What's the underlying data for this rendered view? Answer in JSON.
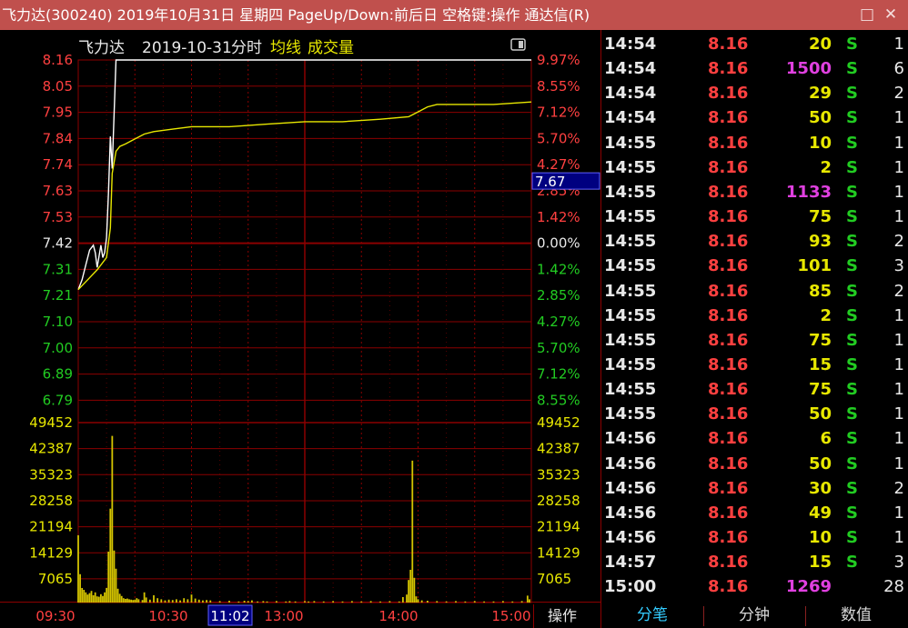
{
  "window": {
    "title": "飞力达(300240) 2019年10月31日 星期四 PageUp/Down:前后日 空格键:操作 通达信(R)",
    "maximize_glyph": "□",
    "close_glyph": "✕"
  },
  "chart_header": {
    "stock_name": "飞力达",
    "date": "2019-10-31",
    "mode": "分时",
    "avg_label": "均线",
    "volume_label": "成交量"
  },
  "price_axis": {
    "ticks": [
      "8.16",
      "8.05",
      "7.95",
      "7.84",
      "7.74",
      "7.63",
      "7.53",
      "7.42",
      "7.31",
      "7.21",
      "7.10",
      "7.00",
      "6.89",
      "6.79"
    ],
    "pct_ticks": [
      "9.97%",
      "8.55%",
      "7.12%",
      "5.70%",
      "4.27%",
      "2.85%",
      "1.42%",
      "0.00%",
      "1.42%",
      "2.85%",
      "4.27%",
      "5.70%",
      "7.12%",
      "8.55%"
    ],
    "marker_value": "7.67"
  },
  "volume_axis": {
    "ticks": [
      "49452",
      "42387",
      "35323",
      "28258",
      "21194",
      "14129",
      "7065"
    ]
  },
  "time_axis": {
    "labels": [
      "09:30",
      "10:30",
      "11:02",
      "13:00",
      "14:00",
      "15:00"
    ]
  },
  "operate_label": "操作",
  "colors": {
    "up": "#ff4040",
    "down": "#22cc22",
    "grid": "#8b0000",
    "price_line": "#ffffff",
    "avg_line": "#e8e800",
    "volume": "#d4c400",
    "selected_time_bg": "#000080"
  },
  "chart_data": {
    "type": "line",
    "x_unit": "minutes since 09:30 open (trading minutes)",
    "ylim": [
      6.68,
      8.16
    ],
    "prev_close": 7.42,
    "series": [
      {
        "name": "价格",
        "x": [
          0,
          2,
          4,
          6,
          8,
          9,
          10,
          12,
          13,
          14,
          15,
          16,
          17,
          18,
          20,
          22,
          24,
          25,
          26,
          28,
          30,
          32,
          34,
          36,
          38,
          40,
          42,
          45,
          48,
          50,
          55,
          60,
          70,
          80,
          100,
          130,
          140,
          160,
          180,
          200,
          210,
          215,
          220,
          230,
          240
        ],
        "values": [
          7.23,
          7.27,
          7.33,
          7.39,
          7.41,
          7.38,
          7.32,
          7.41,
          7.36,
          7.38,
          7.44,
          7.62,
          7.85,
          7.72,
          8.16,
          8.16,
          8.16,
          8.16,
          8.16,
          8.16,
          8.16,
          8.16,
          8.16,
          8.16,
          8.16,
          8.16,
          8.16,
          8.16,
          8.16,
          8.16,
          8.16,
          8.16,
          8.16,
          8.16,
          8.16,
          8.16,
          8.16,
          8.16,
          8.16,
          8.16,
          8.16,
          8.16,
          8.16,
          8.16,
          8.16
        ]
      },
      {
        "name": "均价",
        "x": [
          0,
          5,
          10,
          15,
          17,
          18,
          20,
          22,
          25,
          30,
          35,
          40,
          50,
          60,
          80,
          100,
          120,
          140,
          160,
          175,
          180,
          185,
          190,
          200,
          220,
          240
        ],
        "values": [
          7.23,
          7.27,
          7.31,
          7.36,
          7.48,
          7.7,
          7.79,
          7.81,
          7.82,
          7.84,
          7.86,
          7.87,
          7.88,
          7.89,
          7.89,
          7.9,
          7.91,
          7.91,
          7.92,
          7.93,
          7.95,
          7.97,
          7.98,
          7.98,
          7.98,
          7.99
        ]
      }
    ],
    "volume_series": {
      "name": "成交量",
      "ylim": [
        0,
        49452
      ],
      "bars": [
        [
          0,
          18500
        ],
        [
          1,
          7800
        ],
        [
          2,
          4000
        ],
        [
          3,
          3500
        ],
        [
          4,
          2800
        ],
        [
          5,
          2200
        ],
        [
          6,
          2600
        ],
        [
          7,
          3200
        ],
        [
          8,
          2000
        ],
        [
          9,
          2800
        ],
        [
          10,
          1700
        ],
        [
          11,
          1600
        ],
        [
          12,
          2300
        ],
        [
          13,
          1800
        ],
        [
          14,
          2800
        ],
        [
          15,
          4000
        ],
        [
          16,
          14000
        ],
        [
          17,
          25800
        ],
        [
          18,
          45800
        ],
        [
          19,
          14300
        ],
        [
          20,
          9300
        ],
        [
          21,
          3800
        ],
        [
          22,
          2400
        ],
        [
          23,
          1800
        ],
        [
          24,
          1200
        ],
        [
          25,
          1000
        ],
        [
          26,
          1100
        ],
        [
          27,
          900
        ],
        [
          28,
          800
        ],
        [
          29,
          700
        ],
        [
          30,
          800
        ],
        [
          31,
          1200
        ],
        [
          32,
          900
        ],
        [
          34,
          700
        ],
        [
          35,
          2800
        ],
        [
          36,
          1400
        ],
        [
          38,
          800
        ],
        [
          40,
          2000
        ],
        [
          42,
          1200
        ],
        [
          44,
          900
        ],
        [
          46,
          600
        ],
        [
          48,
          800
        ],
        [
          50,
          700
        ],
        [
          52,
          900
        ],
        [
          54,
          600
        ],
        [
          56,
          1200
        ],
        [
          58,
          900
        ],
        [
          60,
          2200
        ],
        [
          62,
          1100
        ],
        [
          64,
          800
        ],
        [
          66,
          600
        ],
        [
          68,
          700
        ],
        [
          70,
          600
        ],
        [
          75,
          400
        ],
        [
          80,
          500
        ],
        [
          85,
          300
        ],
        [
          88,
          500
        ],
        [
          90,
          400
        ],
        [
          92,
          600
        ],
        [
          95,
          300
        ],
        [
          98,
          400
        ],
        [
          100,
          300
        ],
        [
          105,
          400
        ],
        [
          110,
          300
        ],
        [
          112,
          400
        ],
        [
          115,
          300
        ],
        [
          120,
          400
        ],
        [
          122,
          300
        ],
        [
          125,
          400
        ],
        [
          130,
          300
        ],
        [
          135,
          400
        ],
        [
          140,
          300
        ],
        [
          145,
          400
        ],
        [
          150,
          300
        ],
        [
          155,
          400
        ],
        [
          160,
          300
        ],
        [
          165,
          400
        ],
        [
          170,
          300
        ],
        [
          172,
          1500
        ],
        [
          174,
          2200
        ],
        [
          175,
          6200
        ],
        [
          176,
          9000
        ],
        [
          177,
          39000
        ],
        [
          178,
          6800
        ],
        [
          179,
          1700
        ],
        [
          180,
          900
        ],
        [
          182,
          600
        ],
        [
          185,
          500
        ],
        [
          190,
          400
        ],
        [
          195,
          300
        ],
        [
          200,
          400
        ],
        [
          205,
          300
        ],
        [
          210,
          400
        ],
        [
          215,
          300
        ],
        [
          220,
          300
        ],
        [
          225,
          400
        ],
        [
          230,
          300
        ],
        [
          235,
          400
        ],
        [
          238,
          1900
        ],
        [
          239,
          900
        ]
      ]
    }
  },
  "ticks": [
    {
      "time": "14:54",
      "price": "8.16",
      "vol": "20",
      "vol_color": "#e8e800",
      "side": "S",
      "count": "1"
    },
    {
      "time": "14:54",
      "price": "8.16",
      "vol": "1500",
      "vol_color": "#e040e0",
      "side": "S",
      "count": "6"
    },
    {
      "time": "14:54",
      "price": "8.16",
      "vol": "29",
      "vol_color": "#e8e800",
      "side": "S",
      "count": "2"
    },
    {
      "time": "14:54",
      "price": "8.16",
      "vol": "50",
      "vol_color": "#e8e800",
      "side": "S",
      "count": "1"
    },
    {
      "time": "14:55",
      "price": "8.16",
      "vol": "10",
      "vol_color": "#e8e800",
      "side": "S",
      "count": "1"
    },
    {
      "time": "14:55",
      "price": "8.16",
      "vol": "2",
      "vol_color": "#e8e800",
      "side": "S",
      "count": "1"
    },
    {
      "time": "14:55",
      "price": "8.16",
      "vol": "1133",
      "vol_color": "#e040e0",
      "side": "S",
      "count": "1"
    },
    {
      "time": "14:55",
      "price": "8.16",
      "vol": "75",
      "vol_color": "#e8e800",
      "side": "S",
      "count": "1"
    },
    {
      "time": "14:55",
      "price": "8.16",
      "vol": "93",
      "vol_color": "#e8e800",
      "side": "S",
      "count": "2"
    },
    {
      "time": "14:55",
      "price": "8.16",
      "vol": "101",
      "vol_color": "#e8e800",
      "side": "S",
      "count": "3"
    },
    {
      "time": "14:55",
      "price": "8.16",
      "vol": "85",
      "vol_color": "#e8e800",
      "side": "S",
      "count": "2"
    },
    {
      "time": "14:55",
      "price": "8.16",
      "vol": "2",
      "vol_color": "#e8e800",
      "side": "S",
      "count": "1"
    },
    {
      "time": "14:55",
      "price": "8.16",
      "vol": "75",
      "vol_color": "#e8e800",
      "side": "S",
      "count": "1"
    },
    {
      "time": "14:55",
      "price": "8.16",
      "vol": "15",
      "vol_color": "#e8e800",
      "side": "S",
      "count": "1"
    },
    {
      "time": "14:55",
      "price": "8.16",
      "vol": "75",
      "vol_color": "#e8e800",
      "side": "S",
      "count": "1"
    },
    {
      "time": "14:55",
      "price": "8.16",
      "vol": "50",
      "vol_color": "#e8e800",
      "side": "S",
      "count": "1"
    },
    {
      "time": "14:56",
      "price": "8.16",
      "vol": "6",
      "vol_color": "#e8e800",
      "side": "S",
      "count": "1"
    },
    {
      "time": "14:56",
      "price": "8.16",
      "vol": "50",
      "vol_color": "#e8e800",
      "side": "S",
      "count": "1"
    },
    {
      "time": "14:56",
      "price": "8.16",
      "vol": "30",
      "vol_color": "#e8e800",
      "side": "S",
      "count": "2"
    },
    {
      "time": "14:56",
      "price": "8.16",
      "vol": "49",
      "vol_color": "#e8e800",
      "side": "S",
      "count": "1"
    },
    {
      "time": "14:56",
      "price": "8.16",
      "vol": "10",
      "vol_color": "#e8e800",
      "side": "S",
      "count": "1"
    },
    {
      "time": "14:57",
      "price": "8.16",
      "vol": "15",
      "vol_color": "#e8e800",
      "side": "S",
      "count": "3"
    },
    {
      "time": "15:00",
      "price": "8.16",
      "vol": "1269",
      "vol_color": "#e040e0",
      "side": "",
      "count": "28"
    }
  ],
  "tabs": [
    {
      "label": "分笔",
      "active": true
    },
    {
      "label": "分钟",
      "active": false
    },
    {
      "label": "数值",
      "active": false
    }
  ]
}
